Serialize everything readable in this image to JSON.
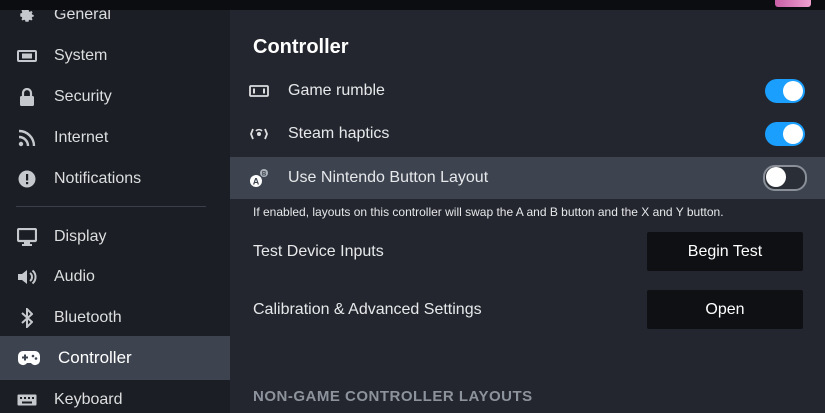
{
  "sidebar": {
    "items": [
      {
        "label": "General",
        "icon": "gear-icon"
      },
      {
        "label": "System",
        "icon": "system-icon"
      },
      {
        "label": "Security",
        "icon": "lock-icon"
      },
      {
        "label": "Internet",
        "icon": "wifi-icon"
      },
      {
        "label": "Notifications",
        "icon": "alert-icon"
      },
      {
        "label": "Display",
        "icon": "monitor-icon"
      },
      {
        "label": "Audio",
        "icon": "speaker-icon"
      },
      {
        "label": "Bluetooth",
        "icon": "bluetooth-icon"
      },
      {
        "label": "Controller",
        "icon": "gamepad-icon",
        "active": true
      },
      {
        "label": "Keyboard",
        "icon": "keyboard-icon"
      }
    ]
  },
  "main": {
    "title": "Controller",
    "rows": [
      {
        "label": "Game rumble",
        "icon": "rumble-icon",
        "toggle": true
      },
      {
        "label": "Steam haptics",
        "icon": "haptics-icon",
        "toggle": true
      },
      {
        "label": "Use Nintendo Button Layout",
        "icon": "ab-button-icon",
        "toggle": false
      }
    ],
    "nintendo_description": "If enabled, layouts on this controller will swap the A and B button and the X and Y button.",
    "test_inputs": {
      "label": "Test Device Inputs",
      "button": "Begin Test"
    },
    "calibration": {
      "label": "Calibration & Advanced Settings",
      "button": "Open"
    },
    "section_header": "NON-GAME CONTROLLER LAYOUTS"
  },
  "colors": {
    "accent": "#1a9fff",
    "sidebar_bg": "#1b1e24",
    "main_bg": "#23262e",
    "active_bg": "#3d4450",
    "button_bg": "#0e1014"
  }
}
